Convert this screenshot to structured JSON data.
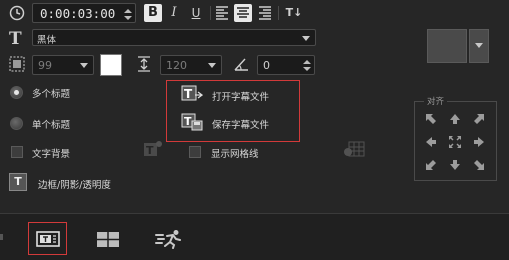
{
  "toolbar": {
    "time_value": "0:00:03:00",
    "bold_label": "B",
    "italic_label": "I",
    "underline_label": "U",
    "text_direction_label": "T↓",
    "font_name": "黑体",
    "transparency_value": "99",
    "font_size_value": "120",
    "angle_value": "0",
    "font_color": "#ffffff"
  },
  "options": {
    "multi_title_label": "多个标题",
    "single_title_label": "单个标题",
    "text_background_label": "文字背景",
    "show_grid_label": "显示网格线",
    "border_shadow_label": "边框/阴影/透明度",
    "open_subtitle_label": "打开字幕文件",
    "save_subtitle_label": "保存字幕文件"
  },
  "align": {
    "group_label": "对齐"
  },
  "colors": {
    "highlight_border": "#d23a3a",
    "background": "#262626"
  }
}
